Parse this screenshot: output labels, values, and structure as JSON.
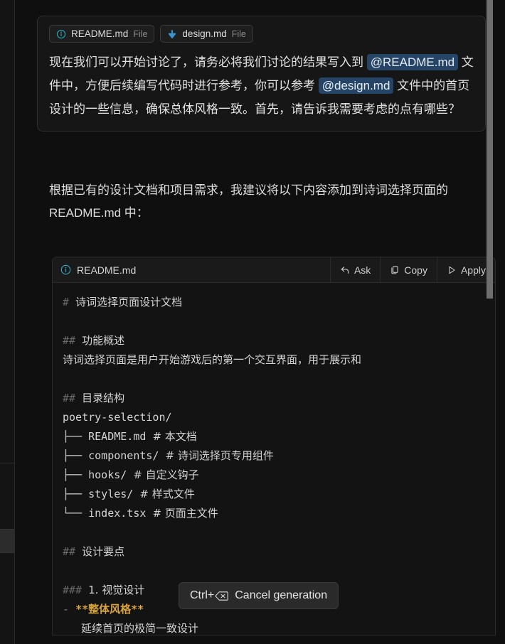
{
  "window": {
    "theme": "dark",
    "bg": "#0f0f0f",
    "accent_blue": "#3794d2",
    "accent_teal": "#2aa1b3",
    "mention_bg": "#264466",
    "bold_orange": "#d9a43b"
  },
  "scrollbar": {
    "name": "chat-scrollbar",
    "thumb_color": "#6e6e6e"
  },
  "prompt": {
    "chips": [
      {
        "icon": "info-circle-icon",
        "label": "README.md",
        "kind": "File"
      },
      {
        "icon": "arrow-down-icon",
        "label": "design.md",
        "kind": "File"
      }
    ],
    "segments": [
      {
        "type": "text",
        "value": "现在我们可以开始讨论了，请务必将我们讨论的结果写入到 "
      },
      {
        "type": "mention",
        "value": "@README.md"
      },
      {
        "type": "text",
        "value": " 文件中，方便后续编写代码时进行参考，你可以参考 "
      },
      {
        "type": "mention",
        "value": "@design.md"
      },
      {
        "type": "text",
        "value": " 文件中的首页设计的一些信息，确保总体风格一致。首先，请告诉我需要考虑的点有哪些？"
      }
    ]
  },
  "assistant": {
    "paragraph": "根据已有的设计文档和项目需求，我建议将以下内容添加到诗词选择页面的 README.md 中："
  },
  "code_card": {
    "icon": "info-circle-icon",
    "filename": "README.md",
    "actions": [
      {
        "icon": "arrow-reply-icon",
        "label": "Ask"
      },
      {
        "icon": "copy-icon",
        "label": "Copy"
      },
      {
        "icon": "play-triangle-icon",
        "label": "Apply"
      }
    ],
    "lines": [
      {
        "type": "heading",
        "marks": "#",
        "text": "诗词选择页面设计文档"
      },
      {
        "type": "blank"
      },
      {
        "type": "heading",
        "marks": "##",
        "text": "功能概述"
      },
      {
        "type": "plain",
        "text": "诗词选择页面是用户开始游戏后的第一个交互界面，用于展示和"
      },
      {
        "type": "blank"
      },
      {
        "type": "heading",
        "marks": "##",
        "text": "目录结构"
      },
      {
        "type": "plain",
        "text": "poetry-selection/"
      },
      {
        "type": "tree",
        "branch": "├──",
        "name": "README.md",
        "comment": "# 本文档"
      },
      {
        "type": "tree",
        "branch": "├──",
        "name": "components/",
        "comment": "# 诗词选择页专用组件"
      },
      {
        "type": "tree",
        "branch": "├──",
        "name": "hooks/",
        "comment": "# 自定义钩子"
      },
      {
        "type": "tree",
        "branch": "├──",
        "name": "styles/",
        "comment": "# 样式文件"
      },
      {
        "type": "tree",
        "branch": "└──",
        "name": "index.tsx",
        "comment": "# 页面主文件"
      },
      {
        "type": "blank"
      },
      {
        "type": "heading",
        "marks": "##",
        "text": "设计要点"
      },
      {
        "type": "blank"
      },
      {
        "type": "heading",
        "marks": "###",
        "text": "1. 视觉设计"
      },
      {
        "type": "bullet_bold",
        "dash": "-",
        "stars": "**",
        "text": "整体风格"
      },
      {
        "type": "partial",
        "text": "延续首页的极简一致设计"
      }
    ]
  },
  "cancel_tooltip": {
    "shortcut": "Ctrl+",
    "key_icon": "backspace-key-icon",
    "label": "Cancel generation"
  }
}
